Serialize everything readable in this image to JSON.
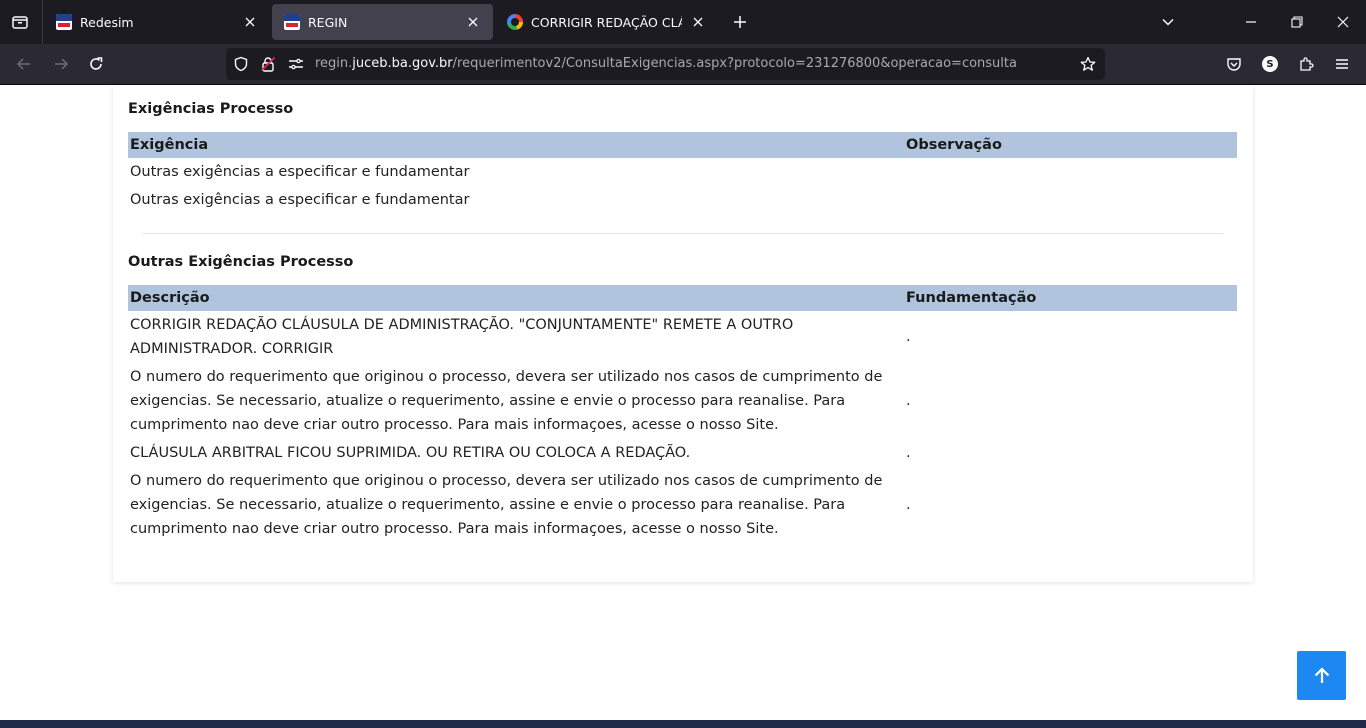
{
  "browser": {
    "tabs": [
      {
        "label": "Redesim",
        "favicon": "ba-flag-icon",
        "active": false
      },
      {
        "label": "REGIN",
        "favicon": "ba-flag-icon",
        "active": true
      },
      {
        "label": "CORRIGIR REDAÇÃO CLÁUSULA",
        "favicon": "google-icon",
        "active": false
      }
    ],
    "url": {
      "prefix": "regin.",
      "host": "juceb.ba.gov.br",
      "path": "/requerimentov2/ConsultaExigencias.aspx?protocolo=231276800&operacao=consulta"
    },
    "profile_initial": "S"
  },
  "exigencias": {
    "title": "Exigências Processo",
    "columns": [
      "Exigência",
      "Observação"
    ],
    "rows": [
      {
        "exigencia": "Outras exigências a especificar e fundamentar",
        "observacao": ""
      },
      {
        "exigencia": "Outras exigências a especificar e fundamentar",
        "observacao": ""
      }
    ]
  },
  "outras": {
    "title": "Outras Exigências Processo",
    "columns": [
      "Descrição",
      "Fundamentação"
    ],
    "rows": [
      {
        "descricao": "CORRIGIR REDAÇÃO CLÁUSULA DE ADMINISTRAÇÃO. \"CONJUNTAMENTE\" REMETE A OUTRO ADMINISTRADOR. CORRIGIR",
        "fundamentacao": "."
      },
      {
        "descricao": "O numero do requerimento que originou o processo, devera ser utilizado nos casos de cumprimento de exigencias. Se necessario, atualize o requerimento, assine e envie o processo para reanalise. Para cumprimento nao deve criar outro processo. Para mais informaçoes, acesse o nosso Site.",
        "fundamentacao": "."
      },
      {
        "descricao": "CLÁUSULA ARBITRAL FICOU SUPRIMIDA. OU RETIRA OU COLOCA A REDAÇÃO.",
        "fundamentacao": "."
      },
      {
        "descricao": "O numero do requerimento que originou o processo, devera ser utilizado nos casos de cumprimento de exigencias. Se necessario, atualize o requerimento, assine e envie o processo para reanalise. Para cumprimento nao deve criar outro processo. Para mais informaçoes, acesse o nosso Site.",
        "fundamentacao": "."
      }
    ]
  },
  "colors": {
    "header_bg": "#b0c4de",
    "scroll_button": "#1e88f2",
    "chrome_dark": "#1c1b22",
    "chrome_nav": "#2b2a33"
  }
}
